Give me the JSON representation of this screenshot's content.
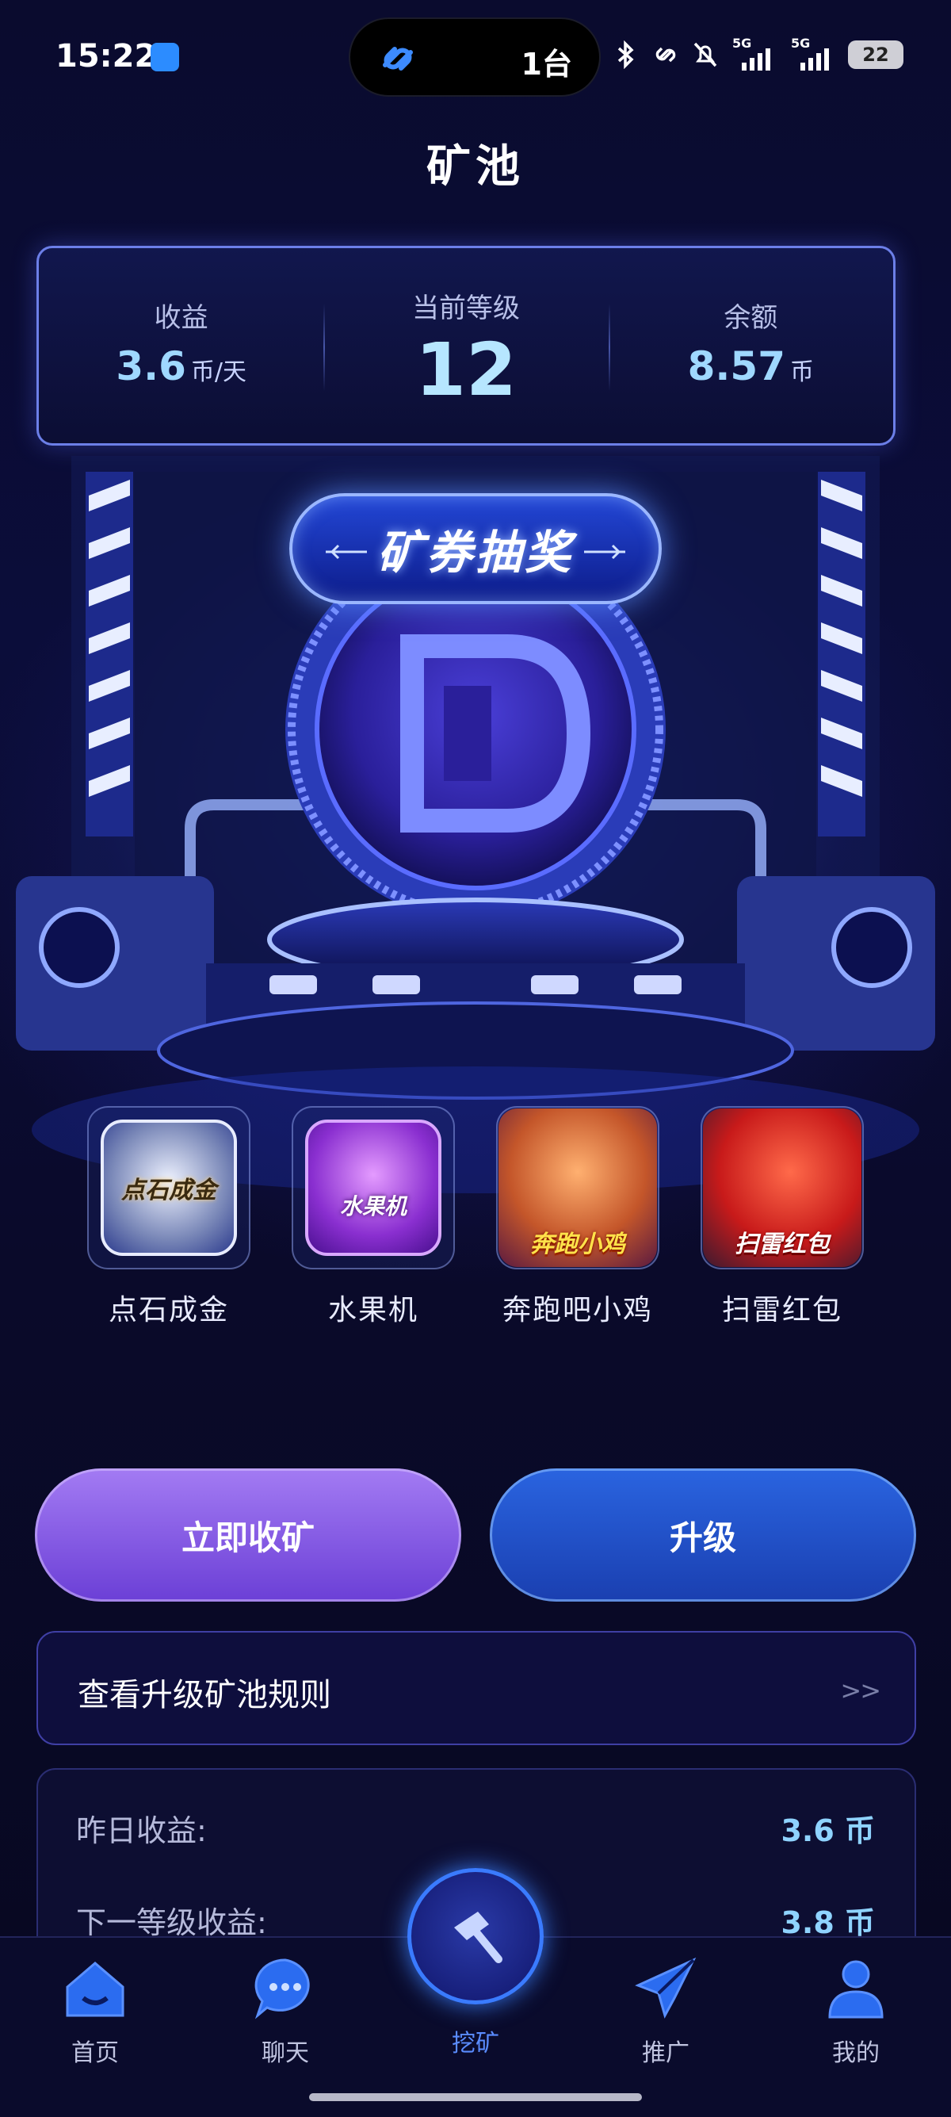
{
  "status_bar": {
    "time": "15:22",
    "island_text": "1台",
    "battery": "22",
    "network_a": "5G",
    "network_b": "5G"
  },
  "page": {
    "title": "矿池"
  },
  "stats": {
    "earnings_label": "收益",
    "earnings_value": "3.6",
    "earnings_unit": "币/天",
    "level_label": "当前等级",
    "level_value": "12",
    "balance_label": "余额",
    "balance_value": "8.57",
    "balance_unit": "币"
  },
  "hero": {
    "lottery_label": "矿券抽奖"
  },
  "games": [
    {
      "name": "点石成金",
      "icon_text": "点石成金",
      "icon": "stone-gold-icon"
    },
    {
      "name": "水果机",
      "icon_text": "水果机",
      "icon": "fruit-machine-icon"
    },
    {
      "name": "奔跑吧小鸡",
      "icon_text": "奔跑小鸡",
      "icon": "running-chick-icon"
    },
    {
      "name": "扫雷红包",
      "icon_text": "扫雷红包",
      "icon": "minesweeper-redpacket-icon"
    }
  ],
  "actions": {
    "collect_label": "立即收矿",
    "upgrade_label": "升级"
  },
  "rules": {
    "label": "查看升级矿池规则",
    "chevron": ">>"
  },
  "earnings": {
    "yesterday_label": "昨日收益:",
    "yesterday_value": "3.6 币",
    "next_level_label": "下一等级收益:",
    "next_level_value": "3.8 币"
  },
  "tabbar": {
    "items": [
      {
        "label": "首页",
        "icon": "home-icon"
      },
      {
        "label": "聊天",
        "icon": "chat-icon"
      },
      {
        "label": "挖矿",
        "icon": "hammer-icon",
        "active": true
      },
      {
        "label": "推广",
        "icon": "send-icon"
      },
      {
        "label": "我的",
        "icon": "profile-icon"
      }
    ]
  },
  "colors": {
    "accent_blue": "#3a7bff",
    "collect_purple": "#8a5ce6",
    "value_cyan": "#9fd8ff",
    "background": "#07081f"
  }
}
